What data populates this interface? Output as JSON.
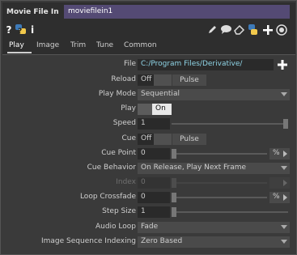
{
  "operator": {
    "type_label": "Movie File In",
    "name": "moviefilein1"
  },
  "header_icons": [
    "help-icon",
    "python-help-icon",
    "info-icon",
    "pencil-icon",
    "comment-icon",
    "eraser-icon",
    "python-icon",
    "add-icon",
    "target-icon"
  ],
  "header_glyphs": {
    "help": "?",
    "info": "i"
  },
  "tabs": [
    {
      "label": "Play",
      "active": true
    },
    {
      "label": "Image",
      "active": false
    },
    {
      "label": "Trim",
      "active": false
    },
    {
      "label": "Tune",
      "active": false
    },
    {
      "label": "Common",
      "active": false
    }
  ],
  "params": {
    "file": {
      "label": "File",
      "value": "C:/Program Files/Derivative/"
    },
    "reload": {
      "label": "Reload",
      "state": "Off",
      "pulse": "Pulse"
    },
    "play_mode": {
      "label": "Play Mode",
      "value": "Sequential"
    },
    "play": {
      "label": "Play",
      "state": "On"
    },
    "speed": {
      "label": "Speed",
      "value": "1",
      "level": 1.0
    },
    "cue": {
      "label": "Cue",
      "state": "Off",
      "pulse": "Pulse"
    },
    "cue_point": {
      "label": "Cue Point",
      "value": "0",
      "unit": "%",
      "level": 0.0
    },
    "cue_behavior": {
      "label": "Cue Behavior",
      "value": "On Release, Play Next Frame"
    },
    "index": {
      "label": "Index",
      "value": "0",
      "level": 0.0,
      "disabled": true
    },
    "loop_crossfade": {
      "label": "Loop Crossfade",
      "value": "0",
      "unit": "%",
      "level": 0.0
    },
    "step_size": {
      "label": "Step Size",
      "value": "1",
      "level": 0.0
    },
    "audio_loop": {
      "label": "Audio Loop",
      "value": "Fade"
    },
    "image_seq_indexing": {
      "label": "Image Sequence Indexing",
      "value": "Zero Based"
    }
  },
  "colors": {
    "name_field": "#544a74",
    "file_path": "#8fd4e6",
    "python_yellow": "#f2c94c",
    "python_blue": "#3d7ab8"
  }
}
